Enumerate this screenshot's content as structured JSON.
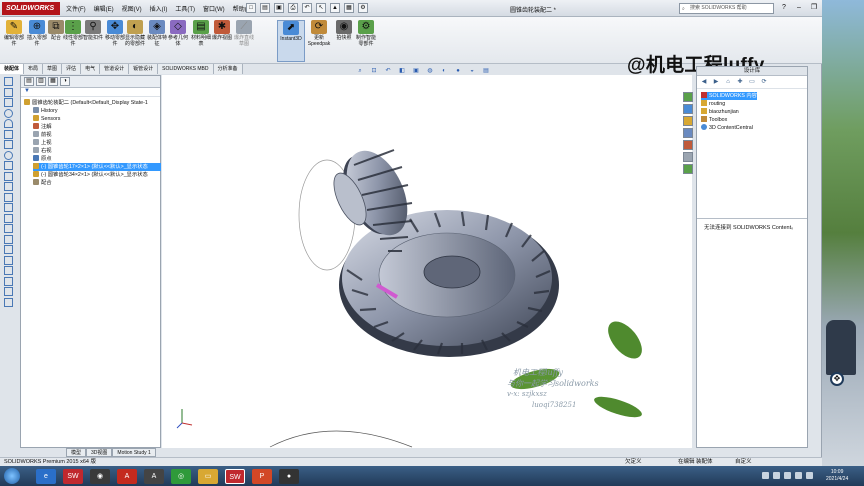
{
  "window": {
    "logo": "SOLIDWORKS",
    "title": "圆锥齿轮装配二 *",
    "menu": [
      "文件(F)",
      "编辑(E)",
      "视图(V)",
      "插入(I)",
      "工具(T)",
      "窗口(W)",
      "帮助(H)"
    ],
    "search_placeholder": "搜索 SOLIDWORKS 帮助"
  },
  "watermark": "@机电工程luffy",
  "toolbar": [
    {
      "label": "编辑零部件",
      "icon": "edit-component-icon",
      "color": "#e2b23a"
    },
    {
      "label": "插入零部件",
      "icon": "insert-component-icon",
      "color": "#4a8bd6"
    },
    {
      "label": "配合",
      "icon": "mate-icon",
      "color": "#9a8a6a"
    },
    {
      "label": "线性零部件",
      "icon": "linear-pattern-icon",
      "color": "#5aa04a"
    },
    {
      "label": "智能扣件",
      "icon": "smart-fastener-icon",
      "color": "#7a7a7a"
    },
    {
      "label": "移动零部件",
      "icon": "move-component-icon",
      "color": "#4a8bd6"
    },
    {
      "label": "显示隐藏的零部件",
      "icon": "show-hidden-icon",
      "color": "#c0a050"
    },
    {
      "label": "装配体特征",
      "icon": "assembly-feature-icon",
      "color": "#6a8ac0"
    },
    {
      "label": "参考几何体",
      "icon": "reference-geometry-icon",
      "color": "#8a6ac0"
    },
    {
      "label": "材料明细表",
      "icon": "bom-icon",
      "color": "#5aa04a"
    },
    {
      "label": "爆炸视图",
      "icon": "exploded-view-icon",
      "color": "#c05a3a"
    },
    {
      "label": "爆炸直线草图",
      "icon": "explode-line-sketch-icon",
      "color": "#9aa4b0"
    },
    {
      "label": "Instant3D",
      "icon": "instant3d-icon",
      "color": "#4a8bd6"
    },
    {
      "label": "更新Speedpak",
      "icon": "speedpak-icon",
      "color": "#c08a3a"
    },
    {
      "label": "拍快照",
      "icon": "snapshot-icon",
      "color": "#6a6a6a"
    },
    {
      "label": "制作智能零部件",
      "icon": "smart-component-icon",
      "color": "#5aa04a"
    }
  ],
  "command_tabs": [
    "装配体",
    "布局",
    "草图",
    "评估",
    "电气",
    "管道设计",
    "钣管设计",
    "SOLIDWORKS MBD",
    "分析准备"
  ],
  "feature_tree": {
    "root": "圆锥齿轮装配二  (Default<Default_Display State-1",
    "items": [
      {
        "label": "History",
        "icon": "history-icon",
        "color": "#7a8ea8"
      },
      {
        "label": "Sensors",
        "icon": "sensor-icon",
        "color": "#d0a030"
      },
      {
        "label": "注解",
        "icon": "annotation-icon",
        "color": "#c05a3a"
      },
      {
        "label": "前视",
        "icon": "plane-icon",
        "color": "#9aa4b0"
      },
      {
        "label": "上视",
        "icon": "plane-icon",
        "color": "#9aa4b0"
      },
      {
        "label": "右视",
        "icon": "plane-icon",
        "color": "#9aa4b0"
      },
      {
        "label": "原点",
        "icon": "origin-icon",
        "color": "#4a78b5"
      },
      {
        "label": "(-) 圆锥齿轮17×2×1> (默认<<默认>_显示状态",
        "icon": "part-icon",
        "color": "#d0a030",
        "selected": true
      },
      {
        "label": "(-) 圆锥齿轮34×2×1> (默认<<默认>_显示状态",
        "icon": "part-icon",
        "color": "#d0a030"
      },
      {
        "label": "配合",
        "icon": "mates-folder-icon",
        "color": "#9a8a6a"
      }
    ]
  },
  "bottom_tabs": [
    "模型",
    "3D视图",
    "Motion Study 1"
  ],
  "task_pane": {
    "header": "设计库",
    "items": [
      {
        "label": "SOLIDWORKS 内容",
        "selected": true
      },
      {
        "label": "routing"
      },
      {
        "label": "biaozhunjian"
      },
      {
        "label": "Toolbox"
      },
      {
        "label": "3D ContentCentral"
      }
    ],
    "message": "无法连接到 SOLIDWORKS Content。"
  },
  "video_watermark": [
    "机电工程luffy",
    "与你一起学习solidworks",
    "v-x: szjkxsz",
    "luoqi738251"
  ],
  "status": {
    "version": "SOLIDWORKS Premium 2015 x64 版",
    "definition": "欠定义",
    "mode": "在编辑 装配体",
    "custom": "自定义"
  },
  "clock": {
    "time": "10:09",
    "date": "2021/4/24"
  },
  "taskbar_apps": [
    {
      "name": "ie-icon",
      "glyph": "e",
      "color": "#2a6fc9"
    },
    {
      "name": "solidworks-icon",
      "glyph": "SW",
      "color": "#c0282e"
    },
    {
      "name": "media-icon",
      "glyph": "◉",
      "color": "#3a3a3a"
    },
    {
      "name": "acrobat-icon",
      "glyph": "A",
      "color": "#c42a1e"
    },
    {
      "name": "cad-icon",
      "glyph": "A",
      "color": "#444"
    },
    {
      "name": "browser-icon",
      "glyph": "◎",
      "color": "#2f9a3a"
    },
    {
      "name": "folder-icon",
      "glyph": "▭",
      "color": "#d8a833"
    },
    {
      "name": "solidworks-2-icon",
      "glyph": "SW",
      "color": "#c0282e"
    },
    {
      "name": "powerpoint-icon",
      "glyph": "P",
      "color": "#d24726"
    },
    {
      "name": "camera-icon",
      "glyph": "●",
      "color": "#333"
    }
  ]
}
